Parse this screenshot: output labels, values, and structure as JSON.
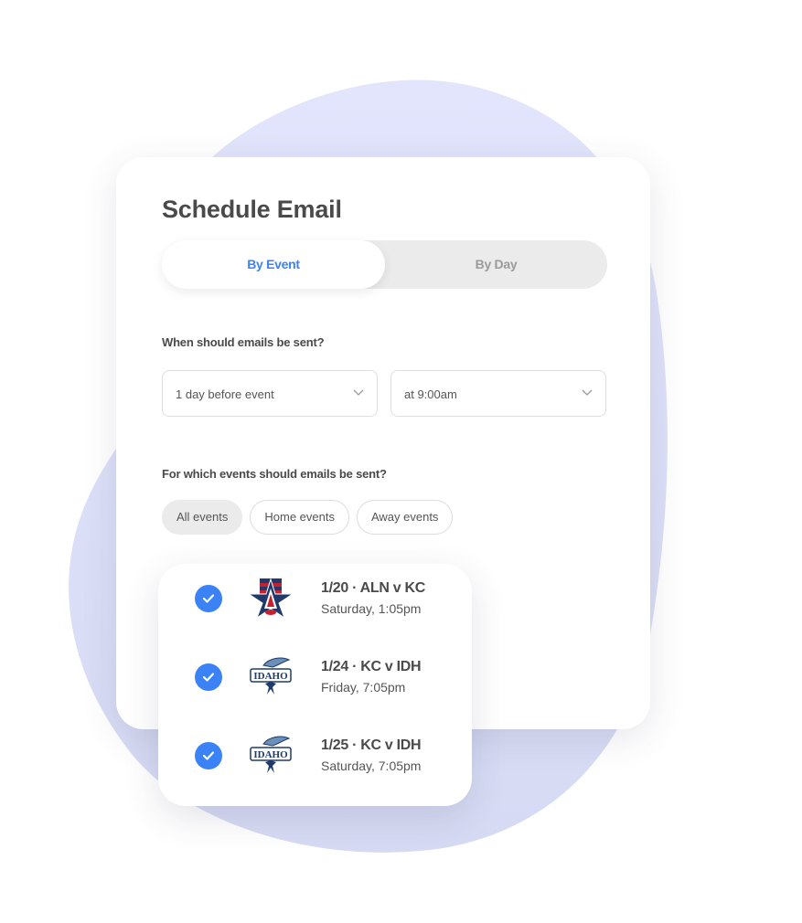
{
  "card": {
    "title": "Schedule Email",
    "tabs": [
      {
        "label": "By Event",
        "active": true
      },
      {
        "label": "By Day",
        "active": false
      }
    ],
    "when_label": "When should emails be sent?",
    "when_selects": [
      {
        "value": "1 day before event"
      },
      {
        "value": "at 9:00am"
      }
    ],
    "which_label": "For which events should emails be sent?",
    "filters": [
      {
        "label": "All events",
        "active": true
      },
      {
        "label": "Home events",
        "active": false
      },
      {
        "label": "Away events",
        "active": false
      }
    ]
  },
  "events": [
    {
      "title": "1/20 · ALN v KC",
      "subtitle": "Saturday, 1:05pm",
      "checked": true,
      "logo": "allen-americans-logo"
    },
    {
      "title": "1/24 · KC v IDH",
      "subtitle": "Friday, 7:05pm",
      "checked": true,
      "logo": "idaho-steelheads-logo"
    },
    {
      "title": "1/25 · KC v IDH",
      "subtitle": "Saturday, 7:05pm",
      "checked": true,
      "logo": "idaho-steelheads-logo"
    }
  ],
  "colors": {
    "accent": "#3b82f6",
    "blob": "#dfe3fb",
    "text": "#4a4a4a"
  }
}
